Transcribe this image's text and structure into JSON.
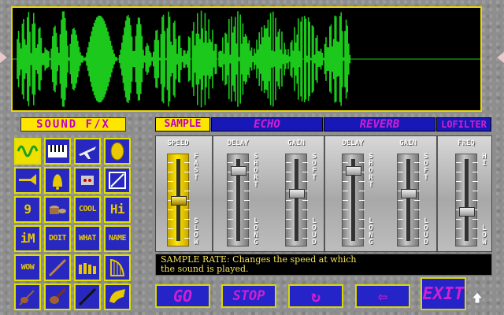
{
  "panel": {
    "title": "SOUND  F/X"
  },
  "tabs": [
    "SAMPLE",
    "ECHO",
    "REVERB",
    "LOFILTER"
  ],
  "icons": [
    {
      "name": "wave-icon",
      "selected": true
    },
    {
      "name": "piano-icon"
    },
    {
      "name": "airplane-icon"
    },
    {
      "name": "cymbal-icon"
    },
    {
      "name": "trumpet-icon"
    },
    {
      "name": "bell-icon"
    },
    {
      "name": "robot-icon"
    },
    {
      "name": "glass-icon"
    },
    {
      "name": "nine-word-icon",
      "text": "9"
    },
    {
      "name": "drums-icon"
    },
    {
      "name": "cool-word-icon",
      "text": "COOL"
    },
    {
      "name": "hi-word-icon",
      "text": "Hi"
    },
    {
      "name": "im-word-icon",
      "text": "iM"
    },
    {
      "name": "doit-word-icon",
      "text": "DOIT"
    },
    {
      "name": "what-word-icon",
      "text": "WHAT"
    },
    {
      "name": "name-word-icon",
      "text": "NAME"
    },
    {
      "name": "wow-word-icon",
      "text": "WOW"
    },
    {
      "name": "flute-icon"
    },
    {
      "name": "xylophone-icon"
    },
    {
      "name": "harp-icon"
    },
    {
      "name": "violin-icon"
    },
    {
      "name": "guitar-icon"
    },
    {
      "name": "clarinet-icon"
    },
    {
      "name": "horn-icon"
    }
  ],
  "faders": {
    "speed": {
      "title": "SPEED",
      "top": "FAST",
      "bottom": "SLOW",
      "value": 0.5
    },
    "echo_delay": {
      "title": "DELAY",
      "top": "SHORT",
      "bottom": "LONG",
      "value": 0.9
    },
    "echo_gain": {
      "title": "GAIN",
      "top": "SOFT",
      "bottom": "LOUD",
      "value": 0.6
    },
    "reverb_delay": {
      "title": "DELAY",
      "top": "SHORT",
      "bottom": "LONG",
      "value": 0.9
    },
    "reverb_gain": {
      "title": "GAIN",
      "top": "SOFT",
      "bottom": "LOUD",
      "value": 0.6
    },
    "freq": {
      "title": "FREQ",
      "top": "HI",
      "bottom": "LOW",
      "value": 0.35
    }
  },
  "status": {
    "line1": "SAMPLE RATE: Changes the speed at which",
    "line2": "the sound is played."
  },
  "buttons": {
    "go": "GO",
    "stop": "STOP",
    "loop": "↻",
    "back": "⇦",
    "exit": "EXIT"
  },
  "colors": {
    "wave": "#1cc81c",
    "accent": "#ffe600",
    "button": "#2424c8",
    "label": "#d020d0"
  }
}
